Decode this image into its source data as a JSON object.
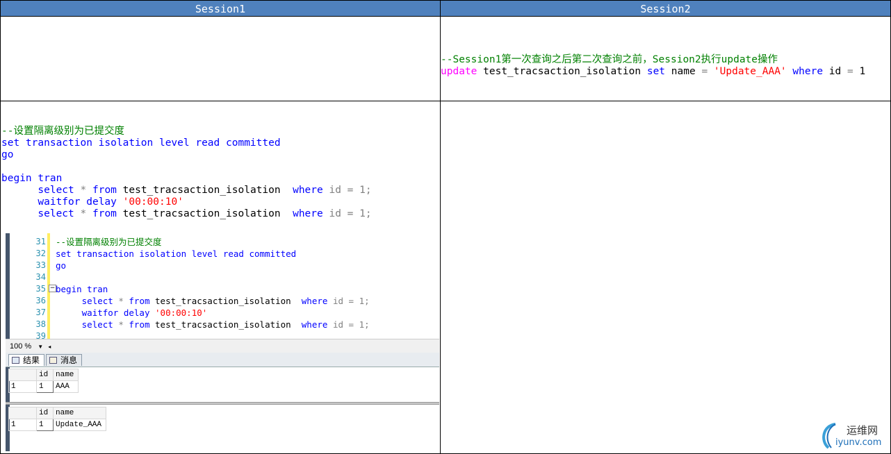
{
  "header": {
    "session1": "Session1",
    "session2": "Session2"
  },
  "session2_top": {
    "comment": "--Session1第一次查询之后第二次查询之前，Session2执行update操作",
    "kw_update": "update",
    "table": "test_tracsaction_isolation",
    "kw_set": "set",
    "col": "name",
    "eq": "=",
    "value": "'Update_AAA'",
    "kw_where": "where",
    "cond": "id",
    "eq2": "=",
    "num": "1"
  },
  "session1_code": {
    "comment": "--设置隔离级别为已提交度",
    "line_set": "set transaction isolation level read committed",
    "line_go": "go",
    "line_begin": "begin tran",
    "select": "select",
    "star": "*",
    "from": "from",
    "table": "test_tracsaction_isolation",
    "where": "where",
    "cond": "id = 1;",
    "waitfor": "waitfor delay",
    "delay": "'00:00:10'"
  },
  "ssms": {
    "line_numbers": [
      "31",
      "32",
      "33",
      "34",
      "35",
      "36",
      "37",
      "38",
      "39"
    ],
    "zoom": "100 %",
    "tabs": [
      "结果",
      "消息"
    ],
    "grid1": {
      "headers": [
        "id",
        "name"
      ],
      "row_num": "1",
      "id": "1",
      "name": "AAA"
    },
    "grid2": {
      "headers": [
        "id",
        "name"
      ],
      "row_num": "1",
      "id": "1",
      "name": "Update_AAA"
    }
  },
  "watermark": {
    "cn": "运维网",
    "en": "iyunv.com"
  },
  "colors": {
    "header_bg": "#4f81bd",
    "keyword": "#0000ff",
    "comment": "#008000",
    "string": "#ff0000",
    "function": "#ff00ff"
  }
}
